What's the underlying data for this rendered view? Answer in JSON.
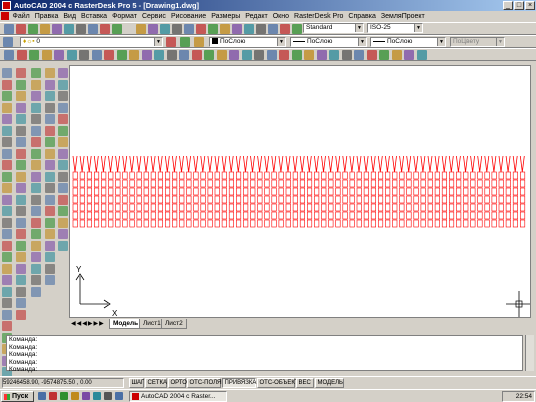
{
  "window": {
    "title": "AutoCAD 2004 с RasterDesk Pro 5 - [Drawing1.dwg]"
  },
  "menu": [
    "Файл",
    "Правка",
    "Вид",
    "Вставка",
    "Формат",
    "Сервис",
    "Рисование",
    "Размеры",
    "Редакт",
    "Окно",
    "RasterDesk Pro",
    "Справка",
    "ЗемляПроект"
  ],
  "toolbar": {
    "layer_value": "0",
    "textstyle": "Standard",
    "dimstyle": "ISO-25",
    "color": "ПоСлою",
    "linetype": "ПоСлою",
    "lineweight": "ПоСлою",
    "plotstyle": "ПоЦвету"
  },
  "layout_tabs": [
    "Модель",
    "Лист1",
    "Лист2"
  ],
  "command_lines": [
    "Команда:",
    "Команда:",
    "Команда:",
    "Команда:",
    "Команда:",
    "Команда:"
  ],
  "status": {
    "coords": "59246458.90, -9574875.50 , 0.00",
    "toggles": [
      {
        "label": "ШАГ",
        "on": false
      },
      {
        "label": "СЕТКА",
        "on": false
      },
      {
        "label": "ОРТО",
        "on": false
      },
      {
        "label": "ОТС-ПОЛЯР",
        "on": false
      },
      {
        "label": "ПРИВЯЗКА",
        "on": true
      },
      {
        "label": "ОТС-ОБЪЕКТ",
        "on": false
      },
      {
        "label": "ВЕС",
        "on": false
      },
      {
        "label": "МОДЕЛЬ",
        "on": false
      }
    ]
  },
  "ucs": {
    "x": "X",
    "y": "Y"
  },
  "taskbar": {
    "start": "Пуск",
    "task": "AutoCAD 2004 с Raster...",
    "clock": "22:54"
  },
  "colors": {
    "drawing_red": "#ff0000",
    "titlebar": "#0a246a"
  }
}
